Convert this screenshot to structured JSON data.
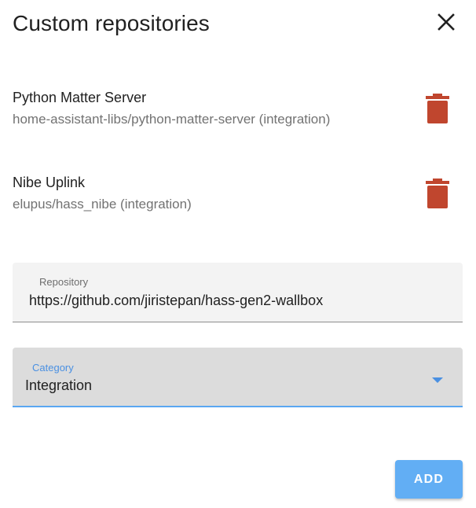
{
  "dialog": {
    "title": "Custom repositories",
    "close_icon": "close-icon"
  },
  "repositories": [
    {
      "name": "Python Matter Server",
      "subtitle": "home-assistant-libs/python-matter-server (integration)",
      "delete_icon": "trash-icon"
    },
    {
      "name": "Nibe Uplink",
      "subtitle": "elupus/hass_nibe (integration)",
      "delete_icon": "trash-icon"
    }
  ],
  "form": {
    "repository_label": "Repository",
    "repository_value": "https://github.com/jiristepan/hass-gen2-wallbox",
    "category_label": "Category",
    "category_value": "Integration",
    "dropdown_icon": "caret-down-icon"
  },
  "actions": {
    "add_label": "ADD"
  },
  "colors": {
    "delete_icon": "#c0462e",
    "accent": "#4a90e2",
    "add_button": "#62aef4"
  }
}
